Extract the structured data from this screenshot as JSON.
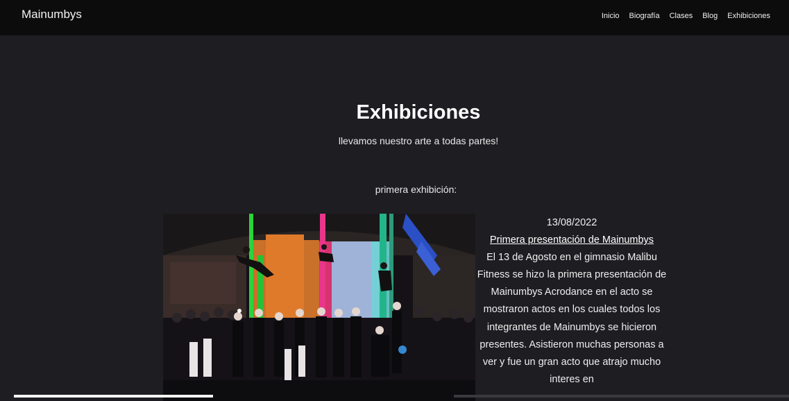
{
  "navbar": {
    "brand": "Mainumbys",
    "links": [
      "Inicio",
      "Biografía",
      "Clases",
      "Blog",
      "Exhibiciones"
    ]
  },
  "header": {
    "title": "Exhibiciones",
    "subtitle": "llevamos nuestro arte a todas partes!"
  },
  "section": {
    "label": "primera exhibición:"
  },
  "event": {
    "date": "13/08/2022",
    "link_text": "Primera presentación de Mainumbys",
    "description": "El 13 de Agosto en el gimnasio Malibu Fitness se hizo la primera presentación de Mainumbys Acrodance en el acto se mostraron actos en los cuales todos los integrantes de Mainumbys se hicieron presentes. Asistieron muchas personas a ver y fue un gran acto que atrajo mucho interes en"
  },
  "colors": {
    "background": "#1e1d22",
    "navbar": "#0c0c0d",
    "text": "#ffffff"
  }
}
